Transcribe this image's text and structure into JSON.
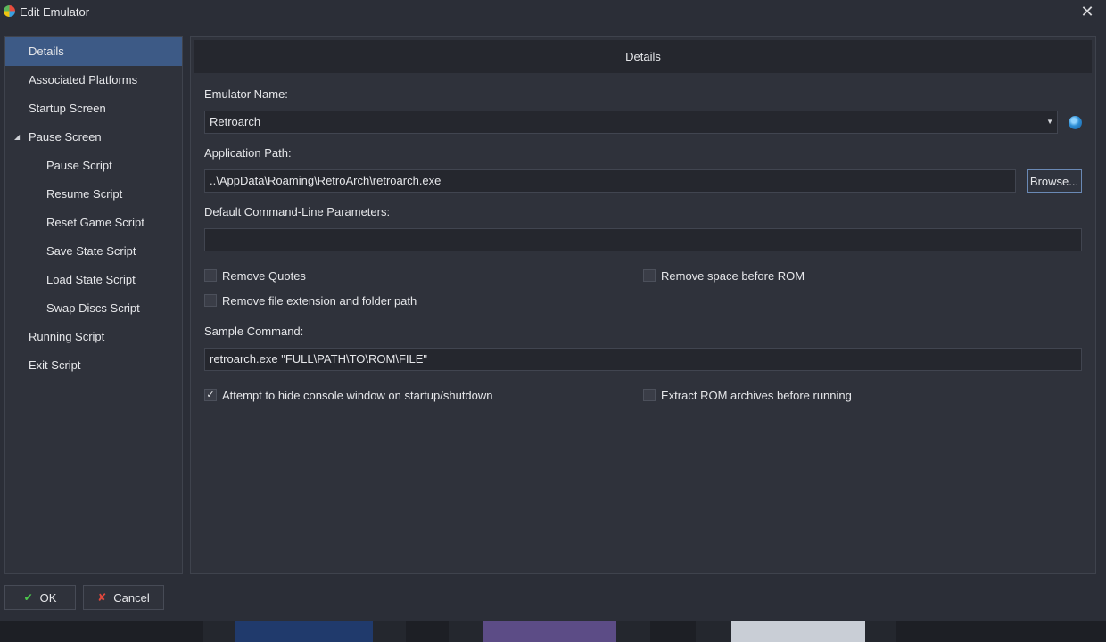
{
  "window": {
    "title": "Edit Emulator"
  },
  "sidebar": {
    "items": [
      {
        "label": "Details",
        "selected": true
      },
      {
        "label": "Associated Platforms"
      },
      {
        "label": "Startup Screen"
      },
      {
        "label": "Pause Screen",
        "expanded": true
      },
      {
        "label": "Pause Script"
      },
      {
        "label": "Resume Script"
      },
      {
        "label": "Reset Game Script"
      },
      {
        "label": "Save State Script"
      },
      {
        "label": "Load State Script"
      },
      {
        "label": "Swap Discs Script"
      },
      {
        "label": "Running Script"
      },
      {
        "label": "Exit Script"
      }
    ]
  },
  "details": {
    "header": "Details",
    "emulator_name_label": "Emulator Name:",
    "emulator_name_value": "Retroarch",
    "application_path_label": "Application Path:",
    "application_path_value": "..\\AppData\\Roaming\\RetroArch\\retroarch.exe",
    "browse_label": "Browse...",
    "params_label": "Default Command-Line Parameters:",
    "params_value": "",
    "remove_quotes": {
      "label": "Remove Quotes",
      "checked": false
    },
    "remove_space": {
      "label": "Remove space before ROM",
      "checked": false
    },
    "remove_ext": {
      "label": "Remove file extension and folder path",
      "checked": false
    },
    "sample_label": "Sample Command:",
    "sample_value": "retroarch.exe \"FULL\\PATH\\TO\\ROM\\FILE\"",
    "hide_console": {
      "label": "Attempt to hide console window on startup/shutdown",
      "checked": true,
      "mark": "✓"
    },
    "extract_rom": {
      "label": "Extract ROM archives before running",
      "checked": false
    }
  },
  "footer": {
    "ok_label": "OK",
    "cancel_label": "Cancel"
  },
  "icons": {
    "app": "launchbox-icon",
    "close": "close-icon",
    "globe": "globe-icon",
    "ok": "check-icon",
    "cancel": "cross-icon"
  },
  "colors": {
    "accent": "#3d5a86",
    "background": "#2b2e37",
    "panel": "#2f323b"
  }
}
